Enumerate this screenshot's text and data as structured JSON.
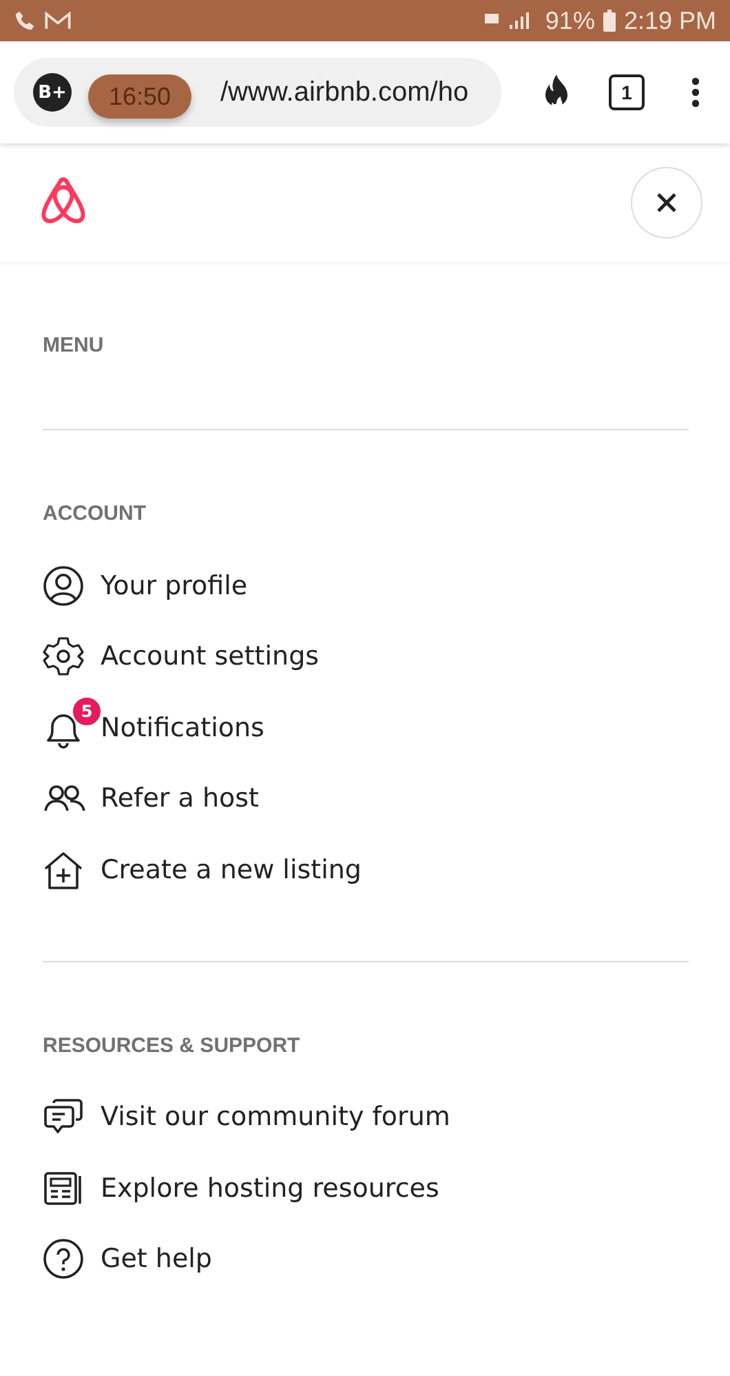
{
  "status_bar": {
    "battery": "91%",
    "time": "2:19 PM"
  },
  "browser": {
    "profile_badge": "B+",
    "url": "/www.airbnb.com/ho",
    "overlay_time": "16:50",
    "tab_count": "1"
  },
  "sections": [
    {
      "heading": "MENU"
    },
    {
      "heading": "ACCOUNT",
      "items": [
        {
          "kind": "profile",
          "label": "Your profile"
        },
        {
          "kind": "settings",
          "label": "Account settings"
        },
        {
          "kind": "bell",
          "label": "Notifications",
          "badge": "5"
        },
        {
          "kind": "people",
          "label": "Refer a host"
        },
        {
          "kind": "house",
          "label": "Create a new listing"
        }
      ]
    },
    {
      "heading": "RESOURCES & SUPPORT",
      "items": [
        {
          "kind": "chat",
          "label": "Visit our community forum"
        },
        {
          "kind": "news",
          "label": "Explore hosting resources"
        },
        {
          "kind": "help",
          "label": "Get help"
        }
      ]
    }
  ]
}
